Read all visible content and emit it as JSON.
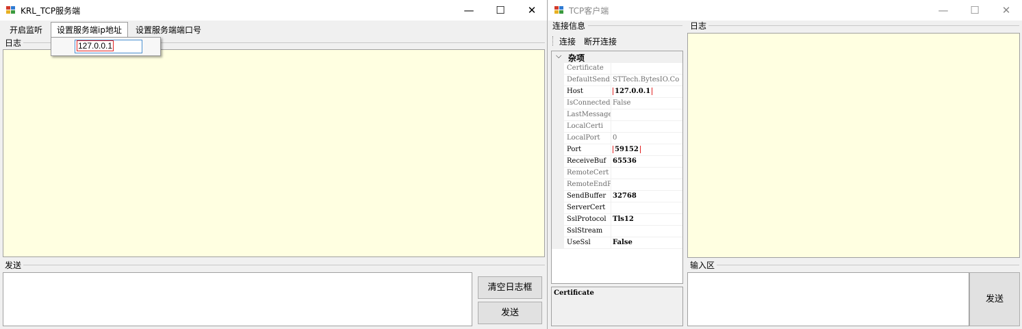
{
  "server_window": {
    "title": "KRL_TCP服务端",
    "menu": {
      "start_listen": "开启监听",
      "set_ip": "设置服务端ip地址",
      "set_port": "设置服务端端口号"
    },
    "ip_dropdown_value": "127.0.0.1",
    "log_label": "日志",
    "send_label": "发送",
    "clear_log_button": "清空日志框",
    "send_button": "发送"
  },
  "client_window": {
    "title": "TCP客户端",
    "conn_info_label": "连接信息",
    "toolbar": {
      "connect": "连接",
      "disconnect": "断开连接"
    },
    "category": "杂项",
    "properties": [
      {
        "name": "Certificate",
        "value": "",
        "bold": false
      },
      {
        "name": "DefaultSend",
        "value": "STTech.BytesIO.Co",
        "bold": false
      },
      {
        "name": "Host",
        "value": "127.0.0.1",
        "bold": true,
        "highlight": true
      },
      {
        "name": "IsConnected",
        "value": "False",
        "bold": false
      },
      {
        "name": "LastMessage",
        "value": "",
        "bold": false
      },
      {
        "name": "LocalCerti",
        "value": "",
        "bold": false
      },
      {
        "name": "LocalPort",
        "value": "0",
        "bold": false
      },
      {
        "name": "Port",
        "value": "59152",
        "bold": true,
        "highlight": true
      },
      {
        "name": "ReceiveBuf",
        "value": "65536",
        "bold": true
      },
      {
        "name": "RemoteCert",
        "value": "",
        "bold": false
      },
      {
        "name": "RemoteEndP",
        "value": "",
        "bold": false
      },
      {
        "name": "SendBuffer",
        "value": "32768",
        "bold": true
      },
      {
        "name": "ServerCert",
        "value": "",
        "bold": true
      },
      {
        "name": "SslProtocol",
        "value": "Tls12",
        "bold": true
      },
      {
        "name": "SslStream",
        "value": "",
        "bold": true
      },
      {
        "name": "UseSsl",
        "value": "False",
        "bold": true
      }
    ],
    "description_title": "Certificate",
    "log_label": "日志",
    "input_label": "输入区",
    "send_button": "发送"
  },
  "window_controls": {
    "minimize": "—",
    "maximize": "☐",
    "close": "✕"
  },
  "colors": {
    "log_background": "#ffffe1",
    "highlight_border": "#e02020",
    "focus_border": "#4a8fd0"
  },
  "icons": [
    "app-icon",
    "minimize-icon",
    "maximize-icon",
    "close-icon",
    "chevron-down-icon"
  ]
}
